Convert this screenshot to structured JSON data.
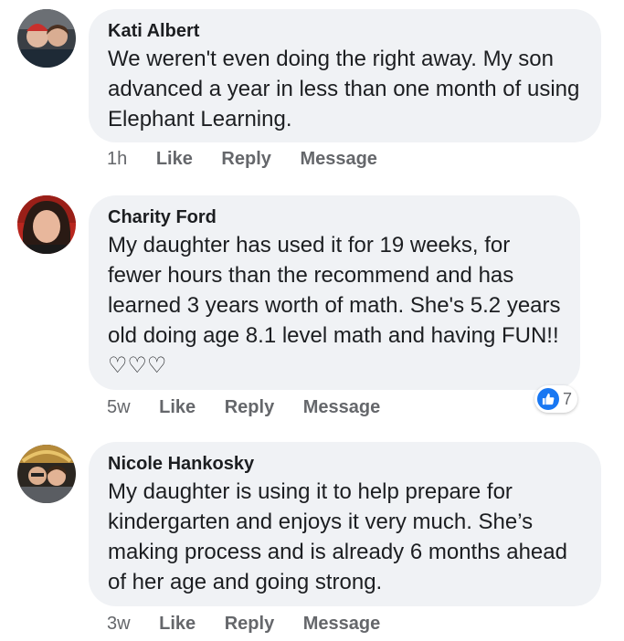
{
  "comments": [
    {
      "author": "Kati Albert",
      "text": "We weren't even doing the right away. My son advanced a year in less than one month of using Elephant Learning.",
      "time": "1h",
      "like_label": "Like",
      "reply_label": "Reply",
      "message_label": "Message"
    },
    {
      "author": "Charity Ford",
      "text": "My daughter has used it for 19 weeks, for fewer hours than the recommend and has learned 3 years worth of math.  She's 5.2 years old doing age 8.1 level math and having FUN!! ♡♡♡",
      "time": "5w",
      "like_label": "Like",
      "reply_label": "Reply",
      "message_label": "Message",
      "reaction_count": "7",
      "reaction_icon": "thumbs-up-icon"
    },
    {
      "author": "Nicole Hankosky",
      "text": "My daughter is using it to help prepare for kindergarten and enjoys it very much. She’s making process and is already 6 months ahead of her age and going strong.",
      "time": "3w",
      "like_label": "Like",
      "reply_label": "Reply",
      "message_label": "Message"
    }
  ],
  "colors": {
    "bubble": "#f0f2f5",
    "meta_text": "#65676b",
    "like_blue": "#1877f2"
  }
}
